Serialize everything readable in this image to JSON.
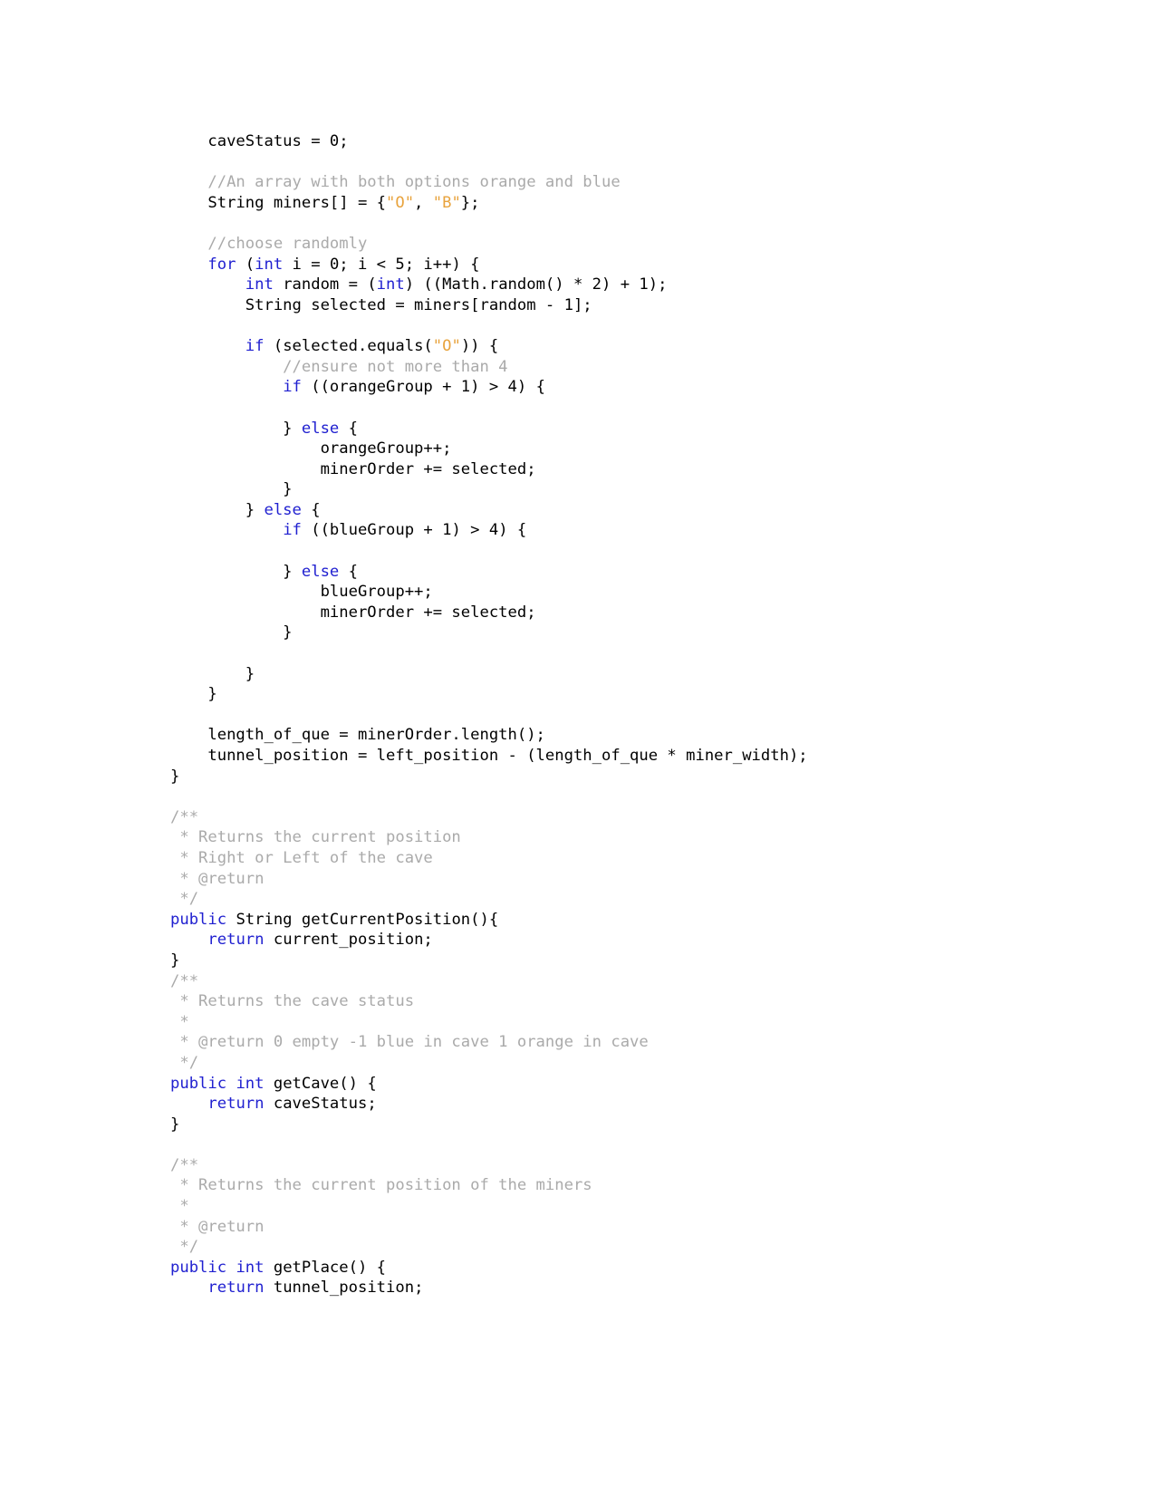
{
  "document": {
    "kind": "java-source-listing",
    "colors": {
      "background": "#ffffff",
      "text": "#000000",
      "keyword": "#2020d0",
      "comment": "#aaaaaa",
      "string": "#e8a33d"
    }
  },
  "code": {
    "language": "Java",
    "lines": [
      {
        "id": 1,
        "segments": [
          {
            "t": "    caveStatus = 0;",
            "c": "plain"
          }
        ]
      },
      {
        "id": 2,
        "segments": [
          {
            "t": "",
            "c": "plain"
          }
        ]
      },
      {
        "id": 3,
        "segments": [
          {
            "t": "    //An array with both options orange and blue",
            "c": "cmt"
          }
        ]
      },
      {
        "id": 4,
        "segments": [
          {
            "t": "    String miners[] = {",
            "c": "plain"
          },
          {
            "t": "\"O\"",
            "c": "str"
          },
          {
            "t": ", ",
            "c": "plain"
          },
          {
            "t": "\"B\"",
            "c": "str"
          },
          {
            "t": "};",
            "c": "plain"
          }
        ]
      },
      {
        "id": 5,
        "segments": [
          {
            "t": "",
            "c": "plain"
          }
        ]
      },
      {
        "id": 6,
        "segments": [
          {
            "t": "    //choose randomly",
            "c": "cmt"
          }
        ]
      },
      {
        "id": 7,
        "segments": [
          {
            "t": "    ",
            "c": "plain"
          },
          {
            "t": "for",
            "c": "kw"
          },
          {
            "t": " (",
            "c": "plain"
          },
          {
            "t": "int",
            "c": "kw"
          },
          {
            "t": " i = 0; i < 5; i++) {",
            "c": "plain"
          }
        ]
      },
      {
        "id": 8,
        "segments": [
          {
            "t": "        ",
            "c": "plain"
          },
          {
            "t": "int",
            "c": "kw"
          },
          {
            "t": " random = (",
            "c": "plain"
          },
          {
            "t": "int",
            "c": "kw"
          },
          {
            "t": ") ((Math.random() * 2) + 1);",
            "c": "plain"
          }
        ]
      },
      {
        "id": 9,
        "segments": [
          {
            "t": "        String selected = miners[random - 1];",
            "c": "plain"
          }
        ]
      },
      {
        "id": 10,
        "segments": [
          {
            "t": "",
            "c": "plain"
          }
        ]
      },
      {
        "id": 11,
        "segments": [
          {
            "t": "        ",
            "c": "plain"
          },
          {
            "t": "if",
            "c": "kw"
          },
          {
            "t": " (selected.equals(",
            "c": "plain"
          },
          {
            "t": "\"O\"",
            "c": "str"
          },
          {
            "t": ")) {",
            "c": "plain"
          }
        ]
      },
      {
        "id": 12,
        "segments": [
          {
            "t": "            //ensure not more than 4",
            "c": "cmt"
          }
        ]
      },
      {
        "id": 13,
        "segments": [
          {
            "t": "            ",
            "c": "plain"
          },
          {
            "t": "if",
            "c": "kw"
          },
          {
            "t": " ((orangeGroup + 1) > 4) {",
            "c": "plain"
          }
        ]
      },
      {
        "id": 14,
        "segments": [
          {
            "t": "",
            "c": "plain"
          }
        ]
      },
      {
        "id": 15,
        "segments": [
          {
            "t": "            } ",
            "c": "plain"
          },
          {
            "t": "else",
            "c": "kw"
          },
          {
            "t": " {",
            "c": "plain"
          }
        ]
      },
      {
        "id": 16,
        "segments": [
          {
            "t": "                orangeGroup++;",
            "c": "plain"
          }
        ]
      },
      {
        "id": 17,
        "segments": [
          {
            "t": "                minerOrder += selected;",
            "c": "plain"
          }
        ]
      },
      {
        "id": 18,
        "segments": [
          {
            "t": "            }",
            "c": "plain"
          }
        ]
      },
      {
        "id": 19,
        "segments": [
          {
            "t": "        } ",
            "c": "plain"
          },
          {
            "t": "else",
            "c": "kw"
          },
          {
            "t": " {",
            "c": "plain"
          }
        ]
      },
      {
        "id": 20,
        "segments": [
          {
            "t": "            ",
            "c": "plain"
          },
          {
            "t": "if",
            "c": "kw"
          },
          {
            "t": " ((blueGroup + 1) > 4) {",
            "c": "plain"
          }
        ]
      },
      {
        "id": 21,
        "segments": [
          {
            "t": "",
            "c": "plain"
          }
        ]
      },
      {
        "id": 22,
        "segments": [
          {
            "t": "            } ",
            "c": "plain"
          },
          {
            "t": "else",
            "c": "kw"
          },
          {
            "t": " {",
            "c": "plain"
          }
        ]
      },
      {
        "id": 23,
        "segments": [
          {
            "t": "                blueGroup++;",
            "c": "plain"
          }
        ]
      },
      {
        "id": 24,
        "segments": [
          {
            "t": "                minerOrder += selected;",
            "c": "plain"
          }
        ]
      },
      {
        "id": 25,
        "segments": [
          {
            "t": "            }",
            "c": "plain"
          }
        ]
      },
      {
        "id": 26,
        "segments": [
          {
            "t": "",
            "c": "plain"
          }
        ]
      },
      {
        "id": 27,
        "segments": [
          {
            "t": "        }",
            "c": "plain"
          }
        ]
      },
      {
        "id": 28,
        "segments": [
          {
            "t": "    }",
            "c": "plain"
          }
        ]
      },
      {
        "id": 29,
        "segments": [
          {
            "t": "",
            "c": "plain"
          }
        ]
      },
      {
        "id": 30,
        "segments": [
          {
            "t": "    length_of_que = minerOrder.length();",
            "c": "plain"
          }
        ]
      },
      {
        "id": 31,
        "segments": [
          {
            "t": "    tunnel_position = left_position - (length_of_que * miner_width);",
            "c": "plain"
          }
        ]
      },
      {
        "id": 32,
        "segments": [
          {
            "t": "}",
            "c": "plain"
          }
        ]
      },
      {
        "id": 33,
        "segments": [
          {
            "t": "",
            "c": "plain"
          }
        ]
      },
      {
        "id": 34,
        "segments": [
          {
            "t": "/**",
            "c": "cmt"
          }
        ]
      },
      {
        "id": 35,
        "segments": [
          {
            "t": " * Returns the current position",
            "c": "cmt"
          }
        ]
      },
      {
        "id": 36,
        "segments": [
          {
            "t": " * Right or Left of the cave",
            "c": "cmt"
          }
        ]
      },
      {
        "id": 37,
        "segments": [
          {
            "t": " * @return",
            "c": "cmt"
          }
        ]
      },
      {
        "id": 38,
        "segments": [
          {
            "t": " */",
            "c": "cmt"
          }
        ]
      },
      {
        "id": 39,
        "segments": [
          {
            "t": "public",
            "c": "kw"
          },
          {
            "t": " String getCurrentPosition(){",
            "c": "plain"
          }
        ]
      },
      {
        "id": 40,
        "segments": [
          {
            "t": "    ",
            "c": "plain"
          },
          {
            "t": "return",
            "c": "kw"
          },
          {
            "t": " current_position;",
            "c": "plain"
          }
        ]
      },
      {
        "id": 41,
        "segments": [
          {
            "t": "}",
            "c": "plain"
          }
        ]
      },
      {
        "id": 42,
        "segments": [
          {
            "t": "/**",
            "c": "cmt"
          }
        ]
      },
      {
        "id": 43,
        "segments": [
          {
            "t": " * Returns the cave status",
            "c": "cmt"
          }
        ]
      },
      {
        "id": 44,
        "segments": [
          {
            "t": " *",
            "c": "cmt"
          }
        ]
      },
      {
        "id": 45,
        "segments": [
          {
            "t": " * @return 0 empty -1 blue in cave 1 orange in cave",
            "c": "cmt"
          }
        ]
      },
      {
        "id": 46,
        "segments": [
          {
            "t": " */",
            "c": "cmt"
          }
        ]
      },
      {
        "id": 47,
        "segments": [
          {
            "t": "public",
            "c": "kw"
          },
          {
            "t": " ",
            "c": "plain"
          },
          {
            "t": "int",
            "c": "kw"
          },
          {
            "t": " getCave() {",
            "c": "plain"
          }
        ]
      },
      {
        "id": 48,
        "segments": [
          {
            "t": "    ",
            "c": "plain"
          },
          {
            "t": "return",
            "c": "kw"
          },
          {
            "t": " caveStatus;",
            "c": "plain"
          }
        ]
      },
      {
        "id": 49,
        "segments": [
          {
            "t": "}",
            "c": "plain"
          }
        ]
      },
      {
        "id": 50,
        "segments": [
          {
            "t": "",
            "c": "plain"
          }
        ]
      },
      {
        "id": 51,
        "segments": [
          {
            "t": "/**",
            "c": "cmt"
          }
        ]
      },
      {
        "id": 52,
        "segments": [
          {
            "t": " * Returns the current position of the miners",
            "c": "cmt"
          }
        ]
      },
      {
        "id": 53,
        "segments": [
          {
            "t": " *",
            "c": "cmt"
          }
        ]
      },
      {
        "id": 54,
        "segments": [
          {
            "t": " * @return",
            "c": "cmt"
          }
        ]
      },
      {
        "id": 55,
        "segments": [
          {
            "t": " */",
            "c": "cmt"
          }
        ]
      },
      {
        "id": 56,
        "segments": [
          {
            "t": "public",
            "c": "kw"
          },
          {
            "t": " ",
            "c": "plain"
          },
          {
            "t": "int",
            "c": "kw"
          },
          {
            "t": " getPlace() {",
            "c": "plain"
          }
        ]
      },
      {
        "id": 57,
        "segments": [
          {
            "t": "    ",
            "c": "plain"
          },
          {
            "t": "return",
            "c": "kw"
          },
          {
            "t": " tunnel_position;",
            "c": "plain"
          }
        ]
      }
    ]
  }
}
